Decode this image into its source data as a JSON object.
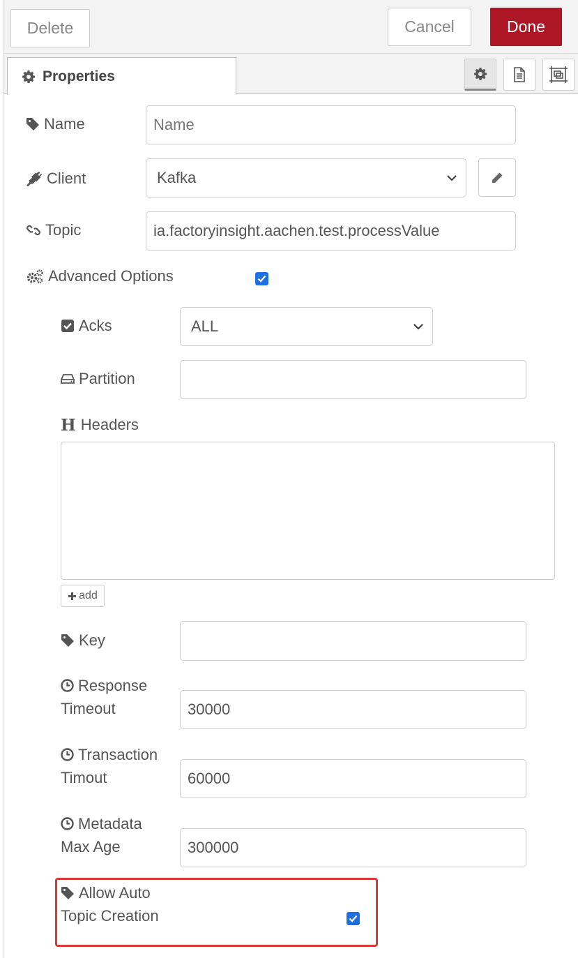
{
  "toolbar": {
    "delete_label": "Delete",
    "cancel_label": "Cancel",
    "done_label": "Done",
    "done_color": "#ad1625"
  },
  "tabs": {
    "properties_label": "Properties",
    "buttons": [
      "gear-icon",
      "document-icon",
      "frame-icon"
    ]
  },
  "form": {
    "name": {
      "label": "Name",
      "placeholder": "Name",
      "value": ""
    },
    "client": {
      "label": "Client",
      "value": "Kafka"
    },
    "topic": {
      "label": "Topic",
      "value": "ia.factoryinsight.aachen.test.processValue"
    },
    "advanced": {
      "label": "Advanced Options",
      "checked": true
    },
    "acks": {
      "label": "Acks",
      "value": "ALL"
    },
    "partition": {
      "label": "Partition",
      "value": ""
    },
    "headers": {
      "label": "Headers",
      "add_label": "add"
    },
    "key": {
      "label": "Key",
      "value": ""
    },
    "response_timeout": {
      "label_line1": "Response",
      "label_line2": "Timeout",
      "value": "30000"
    },
    "transaction_timeout": {
      "label_line1": "Transaction",
      "label_line2": "Timout",
      "value": "60000"
    },
    "metadata_max_age": {
      "label_line1": "Metadata",
      "label_line2": "Max Age",
      "value": "300000"
    },
    "auto_topic": {
      "label_line1": "Allow Auto",
      "label_line2": "Topic Creation",
      "checked": true
    }
  },
  "colors": {
    "checkbox": "#1e6fe0",
    "highlight": "#d83a3a"
  }
}
